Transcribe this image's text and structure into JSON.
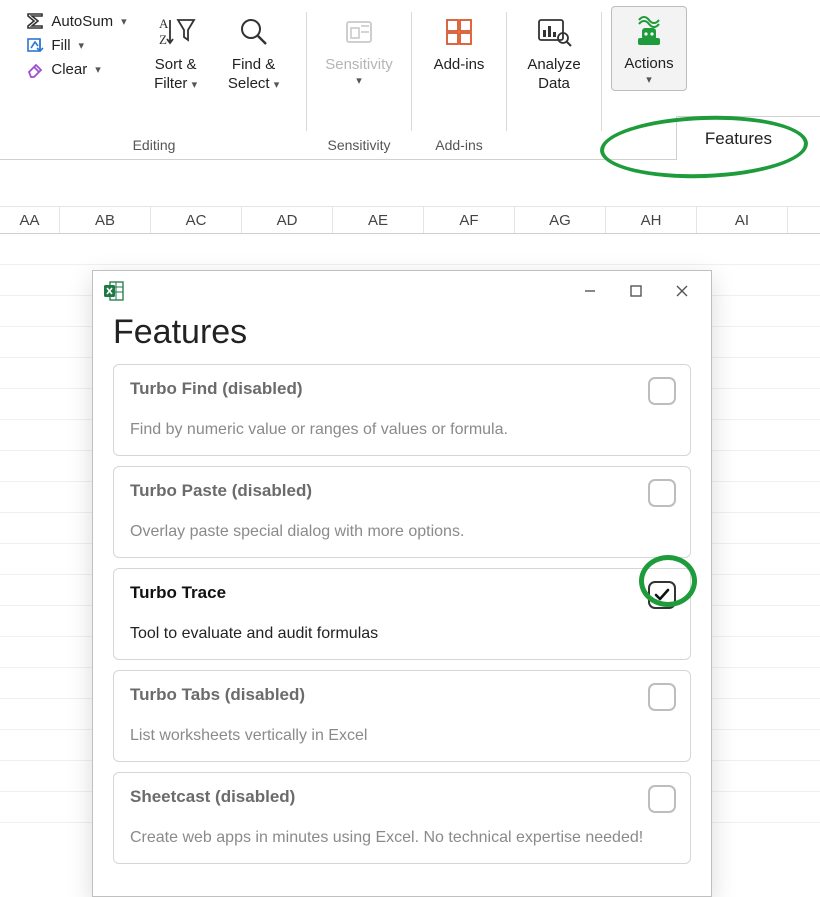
{
  "ribbon": {
    "editing": {
      "label": "Editing",
      "autosum": "AutoSum",
      "fill": "Fill",
      "clear": "Clear",
      "sort_filter_l1": "Sort &",
      "sort_filter_l2": "Filter",
      "find_select_l1": "Find &",
      "find_select_l2": "Select"
    },
    "sensitivity": {
      "label": "Sensitivity",
      "btn": "Sensitivity"
    },
    "addins": {
      "label": "Add-ins",
      "btn": "Add-ins"
    },
    "analyze": {
      "l1": "Analyze",
      "l2": "Data"
    },
    "actions": {
      "btn": "Actions"
    },
    "features_tab": "Features"
  },
  "columns": [
    "AA",
    "AB",
    "AC",
    "AD",
    "AE",
    "AF",
    "AG",
    "AH",
    "AI"
  ],
  "dialog": {
    "heading": "Features",
    "items": [
      {
        "title": "Turbo Find (disabled)",
        "desc": "Find by numeric value or ranges of values or formula.",
        "enabled": false,
        "checked": false
      },
      {
        "title": "Turbo Paste (disabled)",
        "desc": "Overlay paste special dialog with more options.",
        "enabled": false,
        "checked": false
      },
      {
        "title": "Turbo Trace",
        "desc": "Tool to evaluate and audit formulas",
        "enabled": true,
        "checked": true
      },
      {
        "title": "Turbo Tabs (disabled)",
        "desc": "List worksheets vertically in Excel",
        "enabled": false,
        "checked": false
      },
      {
        "title": "Sheetcast (disabled)",
        "desc": "Create web apps in minutes using Excel. No technical expertise needed!",
        "enabled": false,
        "checked": false
      }
    ]
  }
}
